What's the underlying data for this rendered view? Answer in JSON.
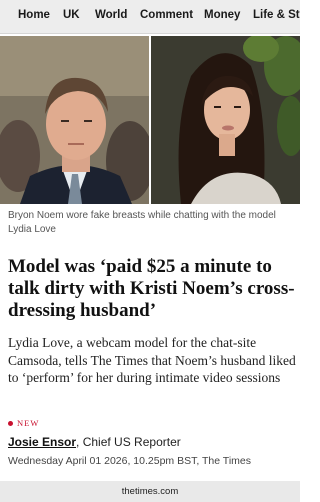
{
  "nav": {
    "items": [
      "Home",
      "UK",
      "World",
      "Comment",
      "Money",
      "Life & Style"
    ]
  },
  "article": {
    "caption": "Bryon Noem wore fake breasts while chatting with the model Lydia Love",
    "headline": "Model was ‘paid $25 a minute to talk dirty with Kristi Noem’s cross-dressing husband’",
    "standfirst": "Lydia Love, a webcam model for the chat-site Camsoda, tells The Times that Noem’s husband liked to ‘perform’ for her during intimate video sessions",
    "badge": "NEW",
    "author": "Josie Ensor",
    "author_role": ", Chief US Reporter",
    "dateline": "Wednesday April 01 2026, 10.25pm BST, The Times"
  },
  "footer": {
    "domain": "thetimes.com"
  },
  "colors": {
    "accent_red": "#c8102e",
    "nav_bg": "#ededed"
  }
}
